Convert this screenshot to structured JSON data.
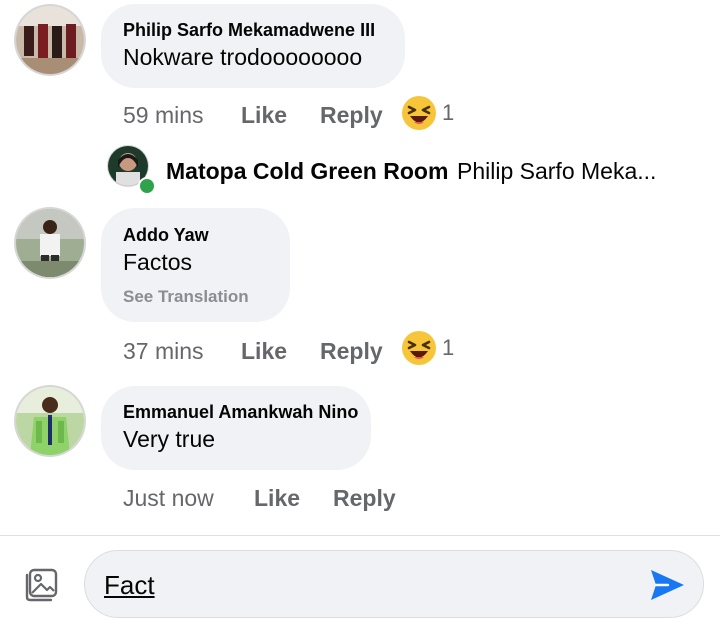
{
  "comments": [
    {
      "author": "Philip Sarfo Mekamadwene III",
      "text": "Nokware trodoooooooo",
      "time": "59 mins",
      "like_label": "Like",
      "reply_label": "Reply",
      "reaction_icon": "laughing-squint-emoji-icon",
      "reaction_count": "1"
    },
    {
      "author": "Addo Yaw",
      "text": "Factos",
      "see_translation": "See Translation",
      "time": "37 mins",
      "like_label": "Like",
      "reply_label": "Reply",
      "reaction_icon": "laughing-squint-emoji-icon",
      "reaction_count": "1"
    },
    {
      "author": "Emmanuel Amankwah Nino",
      "text": "Very true",
      "time": "Just now",
      "like_label": "Like",
      "reply_label": "Reply"
    }
  ],
  "reply_preview": {
    "author": "Matopa Cold Green Room",
    "text": "Philip Sarfo Meka...",
    "online_status_color": "#31a24c"
  },
  "composer": {
    "value": "Fact",
    "photo_icon": "photo-gallery-icon",
    "send_icon": "send-icon",
    "send_color": "#1877f2"
  }
}
